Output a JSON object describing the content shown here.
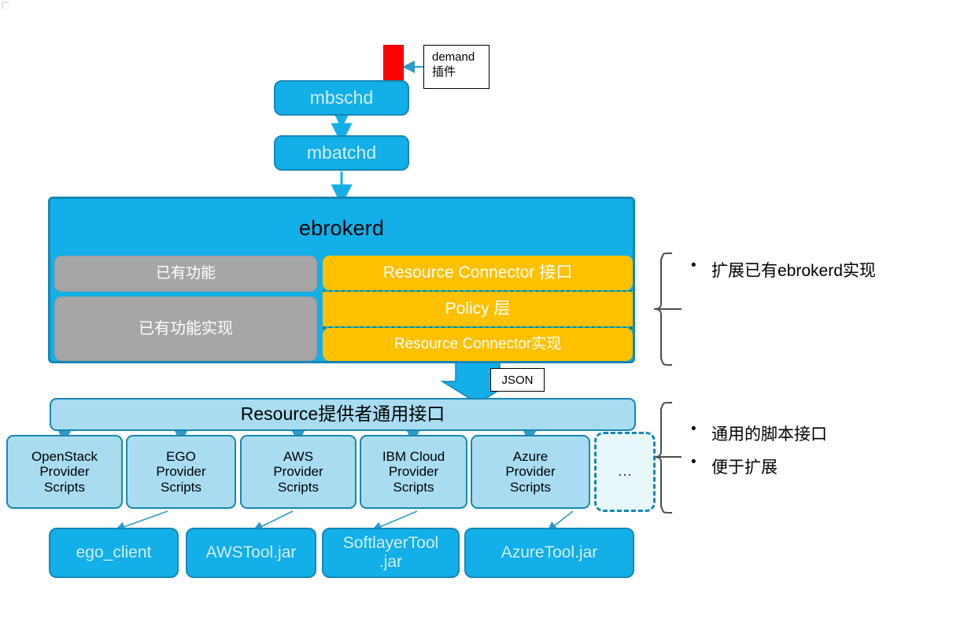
{
  "diagram": {
    "title_nodes": {
      "mbschd": "mbschd",
      "mbatchd": "mbatchd",
      "ebrokerd": "ebrokerd"
    },
    "demand_callout": {
      "line1": "demand",
      "line2": "插件"
    },
    "ebrokerd_children": {
      "existing_function": "已有功能",
      "existing_function_impl": "已有功能实现",
      "rc_interface": "Resource Connector 接口",
      "policy_layer": "Policy 层",
      "rc_impl": "Resource Connector实现"
    },
    "json_tag": "JSON",
    "provider_interface": "Resource提供者通用接口",
    "providers": [
      {
        "label": "OpenStack\nProvider\nScripts"
      },
      {
        "label": "EGO\nProvider\nScripts"
      },
      {
        "label": "AWS\nProvider\nScripts"
      },
      {
        "label": "IBM Cloud\nProvider\nScripts"
      },
      {
        "label": "Azure\nProvider\nScripts"
      },
      {
        "label": "…"
      }
    ],
    "tools": [
      {
        "label": "ego_client"
      },
      {
        "label": "AWSTool.jar"
      },
      {
        "label": "SoftlayerTool\n.jar"
      },
      {
        "label": "AzureTool.jar"
      }
    ],
    "notes_top": [
      {
        "bullet": "•",
        "text": "扩展已有ebrokerd实现"
      }
    ],
    "notes_bottom": [
      {
        "bullet": "•",
        "text": "通用的脚本接口"
      },
      {
        "bullet": "•",
        "text": "便于扩展"
      }
    ],
    "colors": {
      "cyan": "#13AFE8",
      "cyan_border": "#1587B5",
      "gray": "#A6A6A6",
      "orange": "#FFC000",
      "light_blue": "#A9DCF0",
      "pale_blue": "#E8F7FC",
      "red": "#FF0000",
      "dotted_green": "#2E7D32"
    }
  }
}
